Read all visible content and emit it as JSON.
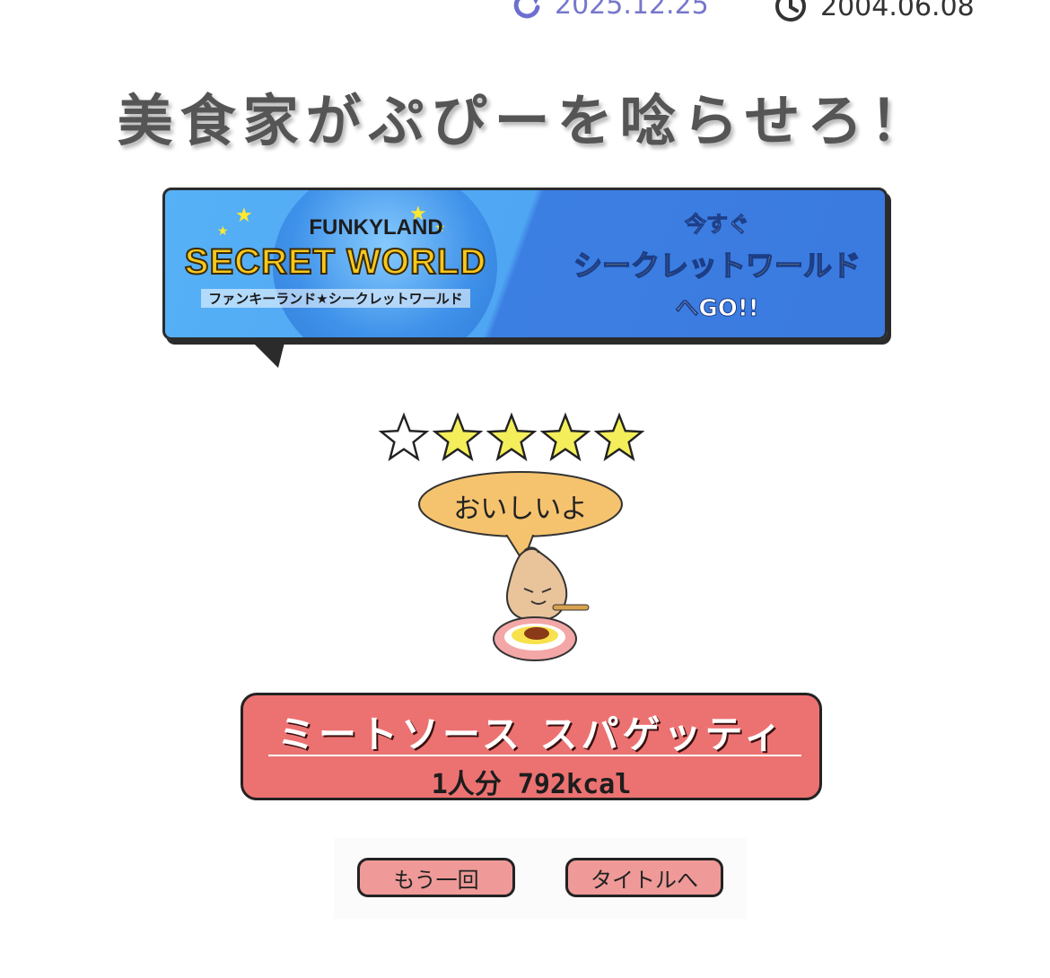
{
  "meta": {
    "updated_date": "2025.12.25",
    "published_date": "2004.06.08",
    "updated_icon": "refresh-icon",
    "published_icon": "clock-icon"
  },
  "page": {
    "title": "美食家がぷぴーを唸らせろ！"
  },
  "banner": {
    "brand_small": "FUNKYLAND",
    "brand_big": "SECRET WORLD",
    "brand_kana": "ファンキーランド★シークレットワールド",
    "cta_line1": "今すぐ",
    "cta_line2": "シークレットワールド",
    "cta_line3": "へGO!!"
  },
  "rating": {
    "value": 4,
    "max": 5
  },
  "speech": {
    "text": "おいしいよ"
  },
  "dish": {
    "name": "ミートソース スパゲッティ",
    "kcal": "1人分 792kcal"
  },
  "buttons": {
    "retry_label": "もう一回",
    "title_label": "タイトルへ"
  },
  "colors": {
    "dish_panel": "#ec7271",
    "button": "#ef9a98",
    "star_filled": "#f3ee5a",
    "bubble": "#f5c36e"
  }
}
